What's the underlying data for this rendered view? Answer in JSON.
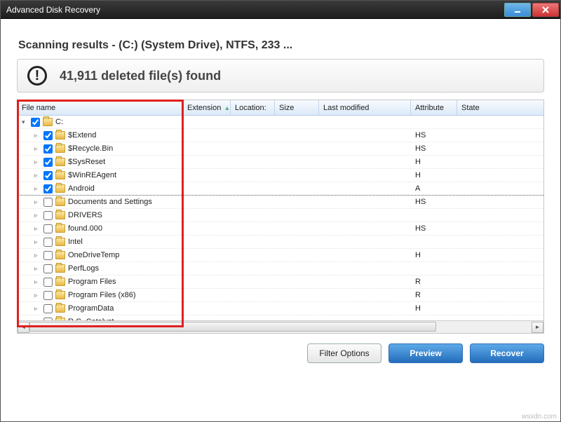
{
  "window": {
    "title": "Advanced Disk Recovery"
  },
  "heading": "Scanning results - (C:)  (System Drive), NTFS, 233 ...",
  "summary": "41,911 deleted file(s) found",
  "columns": {
    "name": "File name",
    "ext": "Extension",
    "loc": "Location:",
    "size": "Size",
    "mod": "Last modified",
    "attr": "Attribute",
    "state": "State"
  },
  "rows": [
    {
      "indent": 0,
      "expander": "▾",
      "checked": true,
      "name": "C:",
      "attr": ""
    },
    {
      "indent": 1,
      "expander": "▸",
      "checked": true,
      "name": "$Extend",
      "attr": "HS"
    },
    {
      "indent": 1,
      "expander": "▸",
      "checked": true,
      "name": "$Recycle.Bin",
      "attr": "HS"
    },
    {
      "indent": 1,
      "expander": "▸",
      "checked": true,
      "name": "$SysReset",
      "attr": "H"
    },
    {
      "indent": 1,
      "expander": "▸",
      "checked": true,
      "name": "$WinREAgent",
      "attr": "H"
    },
    {
      "indent": 1,
      "expander": "▸",
      "checked": true,
      "name": "Android",
      "attr": "A"
    },
    {
      "indent": 1,
      "expander": "▸",
      "checked": false,
      "name": "Documents and Settings",
      "attr": "HS"
    },
    {
      "indent": 1,
      "expander": "▸",
      "checked": false,
      "name": "DRIVERS",
      "attr": ""
    },
    {
      "indent": 1,
      "expander": "▸",
      "checked": false,
      "name": "found.000",
      "attr": "HS"
    },
    {
      "indent": 1,
      "expander": "▸",
      "checked": false,
      "name": "Intel",
      "attr": ""
    },
    {
      "indent": 1,
      "expander": "▸",
      "checked": false,
      "name": "OneDriveTemp",
      "attr": "H"
    },
    {
      "indent": 1,
      "expander": "▸",
      "checked": false,
      "name": "PerfLogs",
      "attr": ""
    },
    {
      "indent": 1,
      "expander": "▸",
      "checked": false,
      "name": "Program Files",
      "attr": "R"
    },
    {
      "indent": 1,
      "expander": "▸",
      "checked": false,
      "name": "Program Files (x86)",
      "attr": "R"
    },
    {
      "indent": 1,
      "expander": "▸",
      "checked": false,
      "name": "ProgramData",
      "attr": "H"
    },
    {
      "indent": 1,
      "expander": "▸",
      "checked": false,
      "name": "R.G. Catalyst",
      "attr": ""
    }
  ],
  "buttons": {
    "filter": "Filter Options",
    "preview": "Preview",
    "recover": "Recover"
  },
  "watermark": "wsxdn.com"
}
